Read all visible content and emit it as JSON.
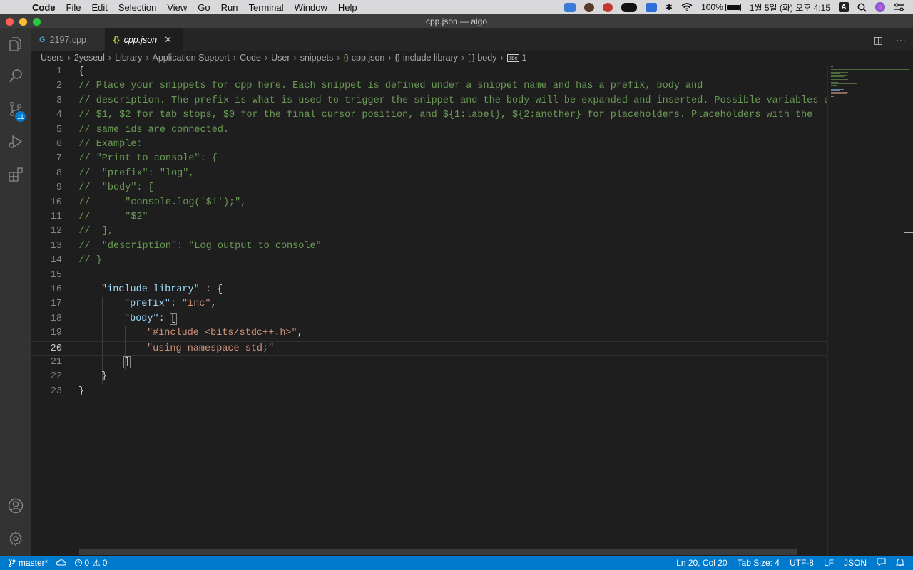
{
  "menubar": {
    "apple_glyph": "",
    "app_name": "Code",
    "items": [
      "File",
      "Edit",
      "Selection",
      "View",
      "Go",
      "Run",
      "Terminal",
      "Window",
      "Help"
    ],
    "battery": "100%",
    "datetime": "1월 5일 (화) 오후 4:15",
    "input_source": "A"
  },
  "window": {
    "title": "cpp.json — algo"
  },
  "activity_bar": {
    "scm_badge": "11"
  },
  "tabs": [
    {
      "label": "2197.cpp",
      "icon": "G",
      "active": false
    },
    {
      "label": "cpp.json",
      "icon": "{}",
      "active": true,
      "close": "✕"
    }
  ],
  "tab_actions": {
    "split": "◫",
    "more": "···"
  },
  "breadcrumb": {
    "path": [
      "Users",
      "2yeseul",
      "Library",
      "Application Support",
      "Code",
      "User",
      "snippets"
    ],
    "file_icon": "{}",
    "file": "cpp.json",
    "obj_icon": "{}",
    "symbol1": "include library",
    "arr_icon": "[ ]",
    "symbol2": "body",
    "str_icon": "abc",
    "symbol3": "1",
    "separator": "›"
  },
  "editor": {
    "line_numbers": [
      "1",
      "2",
      "3",
      "4",
      "5",
      "6",
      "7",
      "8",
      "9",
      "10",
      "11",
      "12",
      "13",
      "14",
      "15",
      "16",
      "17",
      "18",
      "19",
      "20",
      "21",
      "22",
      "23"
    ],
    "current_line": 20,
    "lines": {
      "l1_brace": "{",
      "l2": "    // Place your snippets for cpp here. Each snippet is defined under a snippet name and has a prefix, body and",
      "l3": "    // description. The prefix is what is used to trigger the snippet and the body will be expanded and inserted. Possible variables are:",
      "l4": "    // $1, $2 for tab stops, $0 for the final cursor position, and ${1:label}, ${2:another} for placeholders. Placeholders with the",
      "l5": "    // same ids are connected.",
      "l6": "    // Example:",
      "l7": "    // \"Print to console\": {",
      "l8": "    //  \"prefix\": \"log\",",
      "l9": "    //  \"body\": [",
      "l10": "    //      \"console.log('$1');\",",
      "l11": "    //      \"$2\"",
      "l12": "    //  ],",
      "l13": "    //  \"description\": \"Log output to console\"",
      "l14": "    // }",
      "l16_key": "\"include library\"",
      "l16_rest": " : {",
      "l17_key": "\"prefix\"",
      "l17_sep": ": ",
      "l17_val": "\"inc\"",
      "l17_end": ",",
      "l18_key": "\"body\"",
      "l18_sep": ": ",
      "l18_bracket": "[",
      "l19_val": "\"#include <bits/stdc++.h>\"",
      "l19_end": ",",
      "l20_val": "\"using namespace std;\"",
      "l21_bracket": "]",
      "l22_brace": "}",
      "l23_brace": "}"
    }
  },
  "statusbar": {
    "branch": "master*",
    "errors": "0",
    "warnings": "0",
    "position": "Ln 20, Col 20",
    "tab_size": "Tab Size: 4",
    "encoding": "UTF-8",
    "eol": "LF",
    "language": "JSON"
  },
  "colors": {
    "status_bar": "#007acc",
    "comment": "#6a9955",
    "json_key": "#9cdcfe",
    "json_string": "#ce9178"
  }
}
